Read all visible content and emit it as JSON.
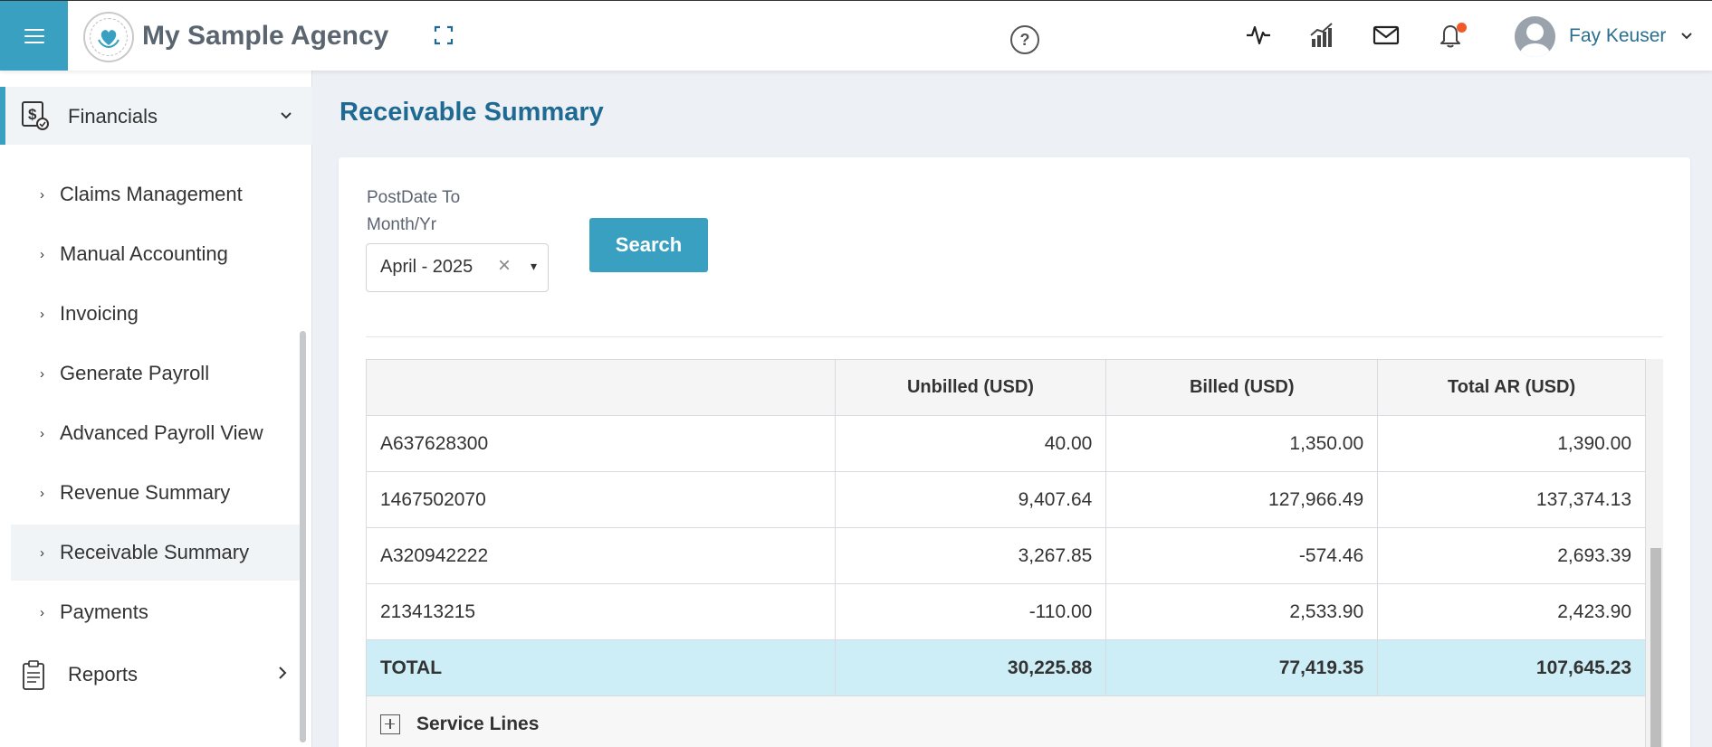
{
  "header": {
    "agency_name": "My Sample Agency",
    "user_name": "Fay Keuser",
    "help_symbol": "?",
    "notification_dot_color": "#f05a28",
    "accent_color": "#3aa0c2",
    "icons": [
      "menu-icon",
      "fullscreen-icon",
      "help-icon",
      "activity-icon",
      "chart-icon",
      "mail-icon",
      "bell-icon",
      "user-avatar-icon",
      "chevron-down-icon"
    ]
  },
  "sidebar": {
    "section": "Financials",
    "items": [
      {
        "label": "Claims Management"
      },
      {
        "label": "Manual Accounting"
      },
      {
        "label": "Invoicing"
      },
      {
        "label": "Generate Payroll"
      },
      {
        "label": "Advanced Payroll View"
      },
      {
        "label": "Revenue Summary"
      },
      {
        "label": "Receivable Summary",
        "active": true
      },
      {
        "label": "Payments"
      }
    ],
    "reports": "Reports"
  },
  "page": {
    "title": "Receivable Summary",
    "filter_label": "PostDate To Month/Yr",
    "filter_value": "April - 2025",
    "clear_symbol": "×",
    "dropdown_symbol": "▾",
    "search_label": "Search"
  },
  "table": {
    "headers": [
      "",
      "Unbilled (USD)",
      "Billed (USD)",
      "Total AR (USD)"
    ],
    "rows": [
      [
        "A637628300",
        "40.00",
        "1,350.00",
        "1,390.00"
      ],
      [
        "1467502070",
        "9,407.64",
        "127,966.49",
        "137,374.13"
      ],
      [
        "A320942222",
        "3,267.85",
        "-574.46",
        "2,693.39"
      ],
      [
        "213413215",
        "-110.00",
        "2,533.90",
        "2,423.90"
      ]
    ],
    "total": [
      "TOTAL",
      "30,225.88",
      "77,419.35",
      "107,645.23"
    ],
    "service_lines": "Service Lines"
  }
}
